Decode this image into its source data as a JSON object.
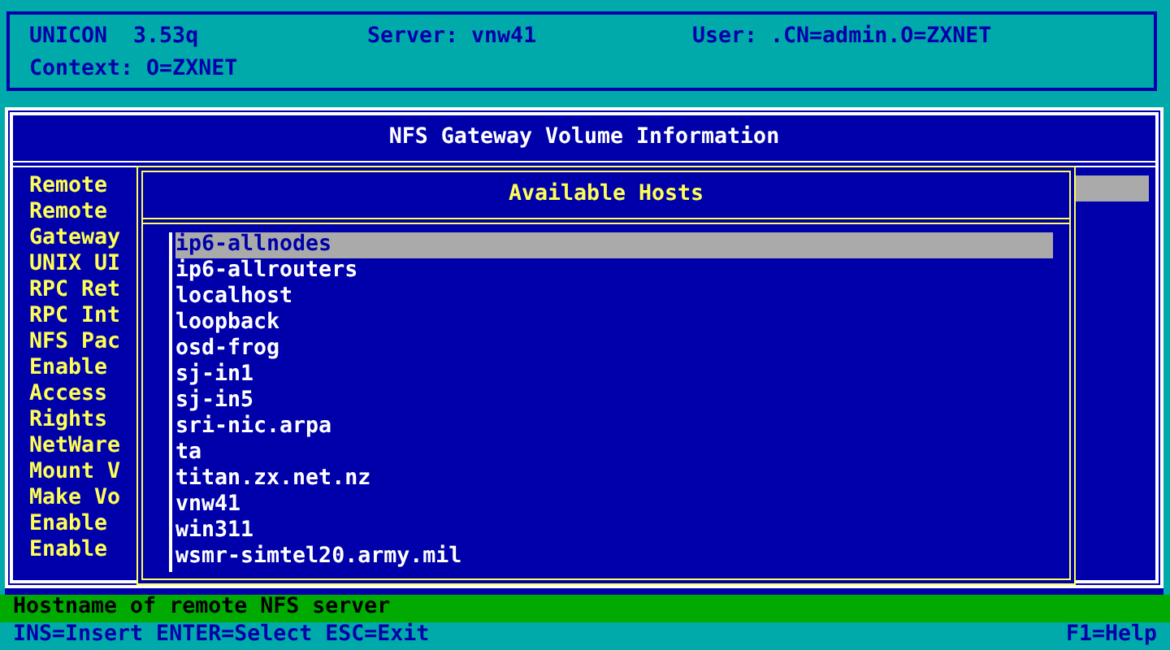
{
  "header": {
    "program": "UNICON  3.53q",
    "server": "Server: vnw41",
    "user": "User: .CN=admin.O=ZXNET",
    "context": "Context: O=ZXNET"
  },
  "window": {
    "title": "NFS Gateway Volume Information",
    "items": [
      "Remote",
      "Remote",
      "Gateway",
      "UNIX UI",
      "RPC Ret",
      "RPC Int",
      "NFS Pac",
      "Enable",
      "Access",
      "Rights",
      "NetWare",
      "Mount V",
      "Make Vo",
      "Enable",
      "Enable"
    ]
  },
  "dialog": {
    "title": "Available Hosts",
    "hosts": [
      {
        "label": "ip6-allnodes",
        "selected": true
      },
      {
        "label": "ip6-allrouters",
        "selected": false
      },
      {
        "label": "localhost",
        "selected": false
      },
      {
        "label": "loopback",
        "selected": false
      },
      {
        "label": "osd-frog",
        "selected": false
      },
      {
        "label": "sj-in1",
        "selected": false
      },
      {
        "label": "sj-in5",
        "selected": false
      },
      {
        "label": "sri-nic.arpa",
        "selected": false
      },
      {
        "label": "ta",
        "selected": false
      },
      {
        "label": "titan.zx.net.nz",
        "selected": false
      },
      {
        "label": "vnw41",
        "selected": false
      },
      {
        "label": "win311",
        "selected": false
      },
      {
        "label": "wsmr-simtel20.army.mil",
        "selected": false
      }
    ]
  },
  "status_bar": {
    "hint": "Hostname of remote NFS server",
    "keys": "INS=Insert ENTER=Select ESC=Exit",
    "help": "F1=Help"
  }
}
